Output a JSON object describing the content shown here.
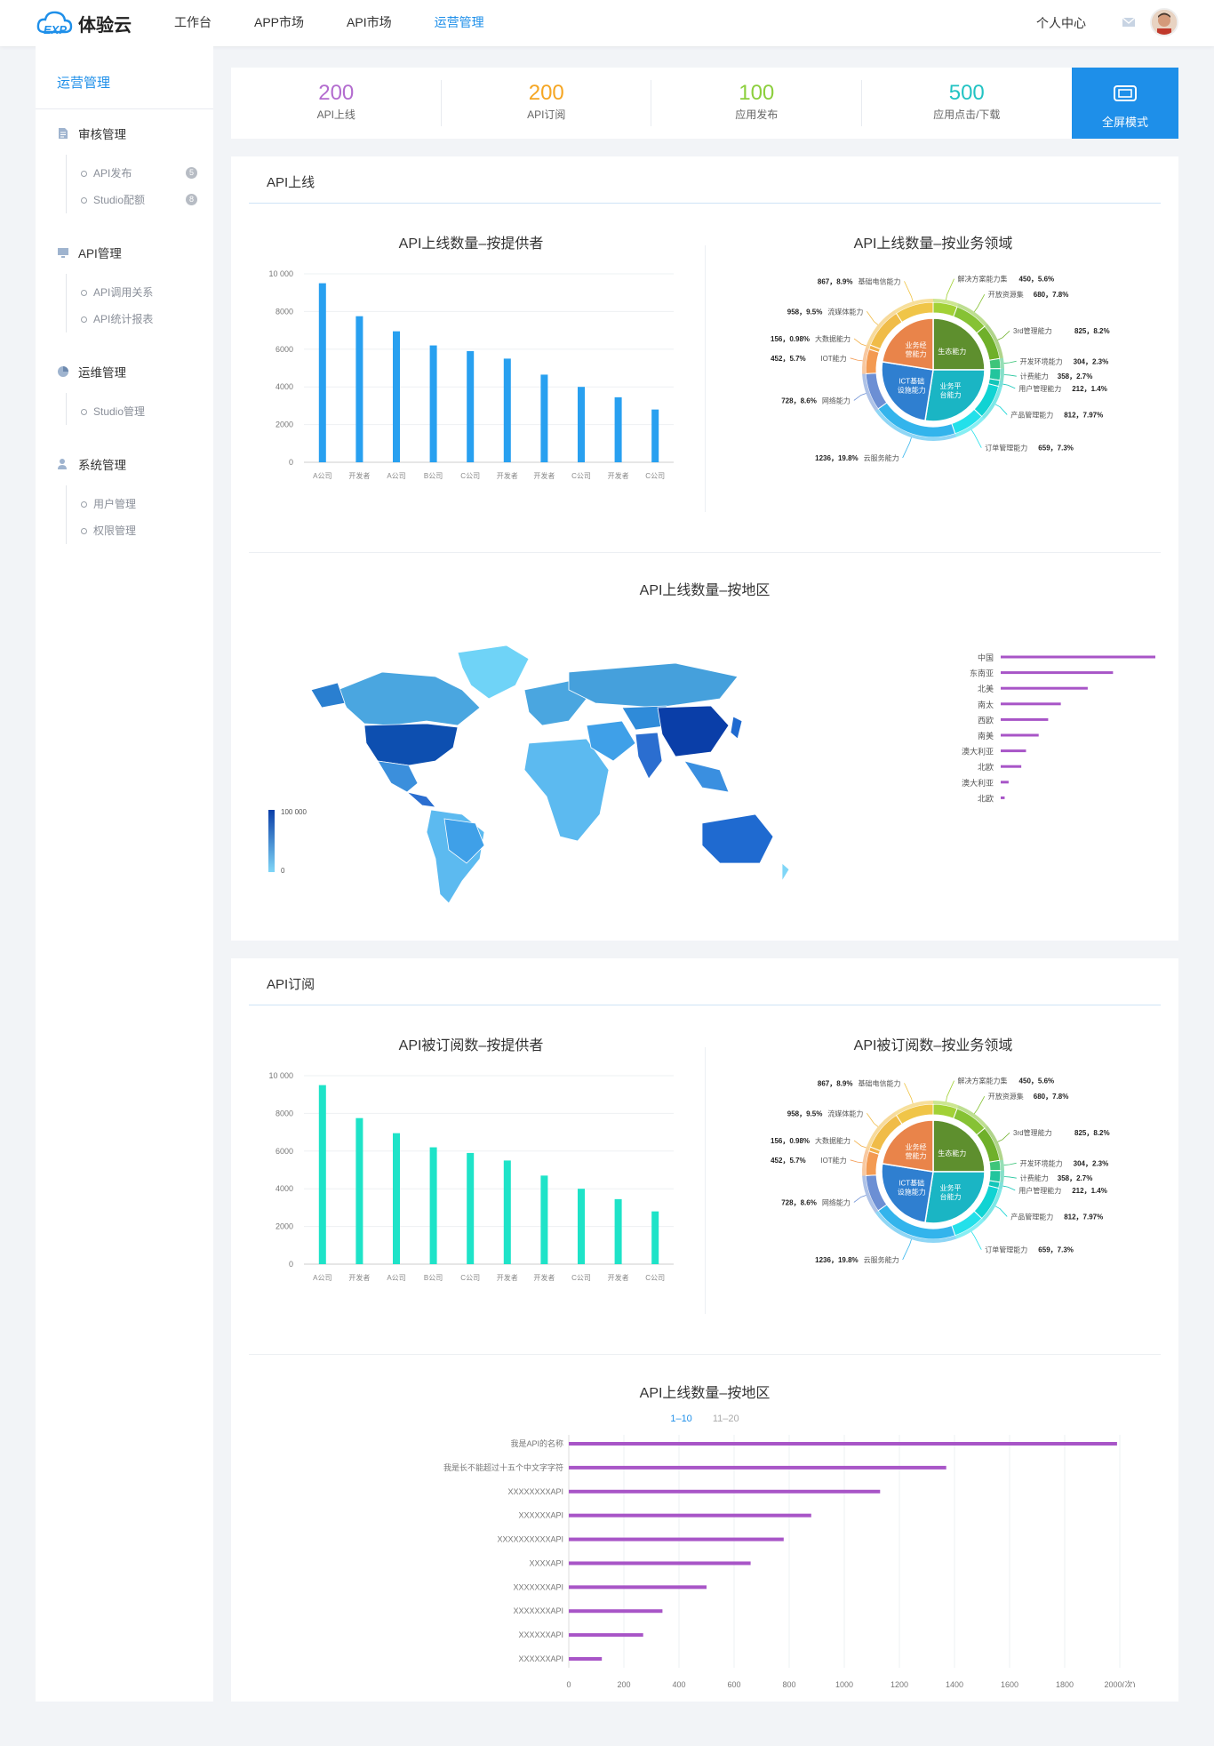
{
  "header": {
    "logo_text": "体验云",
    "nav": [
      {
        "label": "工作台"
      },
      {
        "label": "APP市场"
      },
      {
        "label": "API市场"
      },
      {
        "label": "运营管理"
      }
    ],
    "personal_center": "个人中心"
  },
  "sidebar": {
    "title": "运营管理",
    "groups": [
      {
        "label": "审核管理",
        "icon": "document-icon",
        "items": [
          {
            "label": "API发布",
            "badge": "5"
          },
          {
            "label": "Studio配额",
            "badge": "8"
          }
        ]
      },
      {
        "label": "API管理",
        "icon": "monitor-icon",
        "items": [
          {
            "label": "API调用关系"
          },
          {
            "label": "API统计报表"
          }
        ]
      },
      {
        "label": "运维管理",
        "icon": "pie-icon",
        "items": [
          {
            "label": "Studio管理"
          }
        ]
      },
      {
        "label": "系统管理",
        "icon": "user-icon",
        "items": [
          {
            "label": "用户管理"
          },
          {
            "label": "权限管理"
          }
        ]
      }
    ]
  },
  "stats": [
    {
      "value": "200",
      "label": "API上线",
      "color": "#b36ccf"
    },
    {
      "value": "200",
      "label": "API订阅",
      "color": "#f5a623"
    },
    {
      "value": "100",
      "label": "应用发布",
      "color": "#8ccf3d"
    },
    {
      "value": "500",
      "label": "应用点击/下载",
      "color": "#22c3c3"
    }
  ],
  "fullscreen_label": "全屏模式",
  "colors": {
    "accent": "#1e8fe9",
    "bar_blue": "#28a0f0",
    "bar_teal": "#1ee3c8",
    "bar_purple": "#a855c7"
  },
  "section1": {
    "title": "API上线",
    "bar_title": "API上线数量–按提供者",
    "donut_title": "API上线数量–按业务领域",
    "map_title": "API上线数量–按地区",
    "map_legend_max": "100 000",
    "map_legend_min": "0"
  },
  "section2": {
    "title": "API订阅",
    "bar_title": "API被订阅数–按提供者",
    "donut_title": "API被订阅数–按业务领域",
    "hbar_title": "API上线数量–按地区",
    "page_tabs": [
      "1–10",
      "11–20"
    ]
  },
  "chart_data": [
    {
      "type": "bar",
      "title": "API上线数量–按提供者",
      "categories": [
        "A公司",
        "开发者",
        "A公司",
        "B公司",
        "C公司",
        "开发者",
        "开发者",
        "C公司",
        "开发者",
        "C公司"
      ],
      "values": [
        9500,
        7750,
        6950,
        6200,
        5900,
        5500,
        4650,
        4000,
        3450,
        2800
      ],
      "ylim": [
        0,
        10000
      ],
      "yticks": [
        "0",
        "2000",
        "4000",
        "6000",
        "8000",
        "10 000"
      ],
      "grid": true
    },
    {
      "type": "pie",
      "title": "API上线数量–按业务领域",
      "inner": [
        {
          "name": "生态能力",
          "color": "#5e8f2e"
        },
        {
          "name": "业务平台能力",
          "color": "#1ab5c4"
        },
        {
          "name": "ICT基础设施能力",
          "color": "#2f7fd0"
        },
        {
          "name": "业务经营能力",
          "color": "#e9844a"
        }
      ],
      "slices": [
        {
          "name": "解决方案能力集",
          "label": "450，5.6%",
          "value": 5.6,
          "color": "#a2d136"
        },
        {
          "name": "开放资源集",
          "label": "680，7.8%",
          "value": 7.8,
          "color": "#86c234"
        },
        {
          "name": "3rd管理能力",
          "label": "825，8.2%",
          "value": 8.2,
          "color": "#6fb02a"
        },
        {
          "name": "开发环境能力",
          "label": "304，2.3%",
          "value": 2.3,
          "color": "#3ec57a"
        },
        {
          "name": "计费能力",
          "label": "358，2.7%",
          "value": 2.7,
          "color": "#22c59d"
        },
        {
          "name": "用户管理能力",
          "label": "212，1.4%",
          "value": 1.4,
          "color": "#13c6b9"
        },
        {
          "name": "产品管理能力",
          "label": "812，7.97%",
          "value": 7.97,
          "color": "#10d3d3"
        },
        {
          "name": "订单管理能力",
          "label": "659，7.3%",
          "value": 7.3,
          "color": "#23e0ea"
        },
        {
          "name": "云服务能力",
          "label": "1236，19.8%",
          "value": 19.8,
          "color": "#33b4ec"
        },
        {
          "name": "网络能力",
          "label": "728，8.6%",
          "value": 8.6,
          "color": "#6c8fd4"
        },
        {
          "name": "IOT能力",
          "label": "452，5.7%",
          "value": 5.7,
          "color": "#f39a52"
        },
        {
          "name": "大数据能力",
          "label": "156，0.98%",
          "value": 0.98,
          "color": "#f2b049"
        },
        {
          "name": "流媒体能力",
          "label": "958，9.5%",
          "value": 9.5,
          "color": "#f0bc48"
        },
        {
          "name": "基础电信能力",
          "label": "867，8.9%",
          "value": 8.9,
          "color": "#f0c548"
        }
      ]
    },
    {
      "type": "bar",
      "title": "API上线数量–按地区",
      "orientation": "horizontal",
      "categories": [
        "中国",
        "东南亚",
        "北美",
        "南太",
        "西欧",
        "南美",
        "澳大利亚",
        "北欧",
        "澳大利亚",
        "北欧"
      ],
      "values": [
        100,
        71,
        55,
        38,
        30,
        24,
        16,
        13,
        5,
        2.5
      ]
    },
    {
      "type": "bar",
      "title": "API被订阅数–按提供者",
      "categories": [
        "A公司",
        "开发者",
        "A公司",
        "B公司",
        "C公司",
        "开发者",
        "开发者",
        "C公司",
        "开发者",
        "C公司"
      ],
      "values": [
        9500,
        7750,
        6950,
        6200,
        5900,
        5500,
        4700,
        4000,
        3450,
        2800
      ],
      "ylim": [
        0,
        10000
      ],
      "yticks": [
        "0",
        "2000",
        "4000",
        "6000",
        "8000",
        "10 000"
      ],
      "grid": true
    },
    {
      "type": "pie",
      "title": "API被订阅数–按业务领域",
      "same_as_previous_donut": true
    },
    {
      "type": "bar",
      "title": "API上线数量–按地区",
      "orientation": "horizontal",
      "categories": [
        "我是API的名称",
        "我是长不能超过十五个中文字字符",
        "XXXXXXXXAPI",
        "XXXXXXAPI",
        "XXXXXXXXXXAPI",
        "XXXXAPI",
        "XXXXXXXAPI",
        "XXXXXXXAPI",
        "XXXXXXAPI",
        "XXXXXXAPI"
      ],
      "values": [
        1990,
        1370,
        1130,
        880,
        780,
        660,
        500,
        340,
        270,
        120
      ],
      "xlim": [
        0,
        2000
      ],
      "xticks": [
        "0",
        "200",
        "400",
        "600",
        "800",
        "1000",
        "1200",
        "1400",
        "1600",
        "1800",
        "2000(次)"
      ],
      "grid": true
    }
  ]
}
